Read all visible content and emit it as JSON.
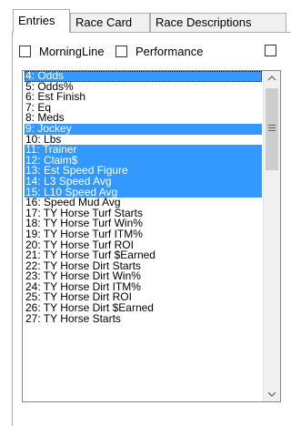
{
  "tabs": [
    {
      "label": "Entries",
      "active": true
    },
    {
      "label": "Race Card",
      "active": false
    },
    {
      "label": "Race Descriptions",
      "active": false
    }
  ],
  "checkboxes": {
    "morningline": {
      "label": "MorningLine",
      "checked": false
    },
    "performance": {
      "label": "Performance",
      "checked": false
    },
    "third": {
      "label": "",
      "checked": false
    }
  },
  "list": {
    "items": [
      {
        "text": "4: Odds",
        "selected": true
      },
      {
        "text": "5: Odds%",
        "selected": false
      },
      {
        "text": "6: Est Finish",
        "selected": false
      },
      {
        "text": "7: Eq",
        "selected": false
      },
      {
        "text": "8: Meds",
        "selected": false
      },
      {
        "text": "9: Jockey",
        "selected": true
      },
      {
        "text": "10: Lbs",
        "selected": false
      },
      {
        "text": "11: Trainer",
        "selected": true
      },
      {
        "text": "12: Claim$",
        "selected": true
      },
      {
        "text": "13: Est Speed Figure",
        "selected": true
      },
      {
        "text": "14: L3 Speed Avg",
        "selected": true
      },
      {
        "text": "15: L10 Speed Avg",
        "selected": true
      },
      {
        "text": "16: Speed Mud Avg",
        "selected": false
      },
      {
        "text": "17: TY Horse Turf Starts",
        "selected": false
      },
      {
        "text": "18: TY Horse Turf Win%",
        "selected": false
      },
      {
        "text": "19: TY Horse Turf ITM%",
        "selected": false
      },
      {
        "text": "20: TY Horse Turf ROI",
        "selected": false
      },
      {
        "text": "21: TY Horse Turf $Earned",
        "selected": false
      },
      {
        "text": "22: TY Horse Dirt Starts",
        "selected": false
      },
      {
        "text": "23: TY Horse Dirt Win%",
        "selected": false
      },
      {
        "text": "24: TY Horse Dirt ITM%",
        "selected": false
      },
      {
        "text": "25: TY Horse Dirt ROI",
        "selected": false
      },
      {
        "text": "26: TY Horse Dirt $Earned",
        "selected": false
      },
      {
        "text": "27: TY Horse Starts",
        "selected": false
      }
    ]
  },
  "scrollbar": {
    "up_icon": "chevron-up-icon",
    "down_icon": "chevron-down-icon"
  },
  "colors": {
    "selection": "#3399ff",
    "selection_text": "#ffffff",
    "tab_inactive": "#f0f0f0",
    "border": "#adadad"
  }
}
